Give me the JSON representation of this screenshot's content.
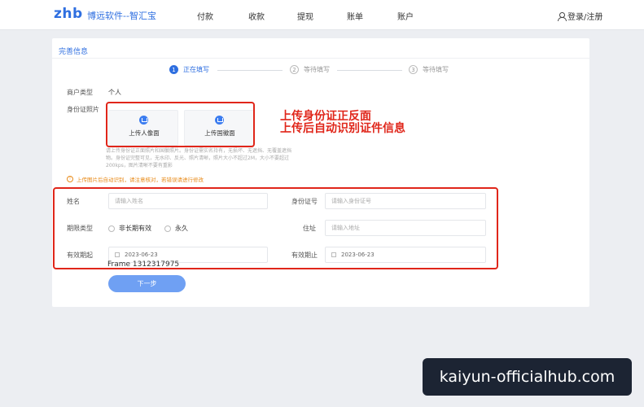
{
  "header": {
    "logo": "zhb",
    "brand_name": "博远软件--智汇宝",
    "nav": [
      "付款",
      "收款",
      "提现",
      "账单",
      "账户"
    ],
    "login": "登录/注册"
  },
  "card": {
    "title": "完善信息",
    "steps": [
      {
        "num": "1",
        "label": "正在填写"
      },
      {
        "num": "2",
        "label": "等待填写"
      },
      {
        "num": "3",
        "label": "等待填写"
      }
    ],
    "merchant_type_label": "商户类型",
    "merchant_type_value": "个人",
    "id_photo_label": "身份证照片",
    "upload_front": "上传人像面",
    "upload_back": "上传国徽面",
    "hint": "请上传身份证正面照片和国徽照片。身份证需实名持有，无损坏、无遮挡、无覆盖遮挡物。身份证完整可见，无水印、反光、照片清晰，照片大小不超过2M，大小不要超过200kps，图片清晰不要有重影",
    "warning": "上传图片后自动识别，请注意核对，若错误请进行修改",
    "form": {
      "name_label": "姓名",
      "name_placeholder": "请输入姓名",
      "id_label": "身份证号",
      "id_placeholder": "请输入身份证号",
      "period_label": "期限类型",
      "period_option1": "非长期有效",
      "period_option2": "永久",
      "address_label": "住址",
      "address_placeholder": "请输入地址",
      "start_label": "有效期起",
      "start_value": "2023-06-23",
      "end_label": "有效期止",
      "end_value": "2023-06-23"
    },
    "frame_label": "Frame 1312317975",
    "next_button": "下一步"
  },
  "annotation": {
    "line1": "上传身份证正反面",
    "line2": "上传后自动识别证件信息"
  },
  "watermark": "kaiyun-officialhub.com"
}
